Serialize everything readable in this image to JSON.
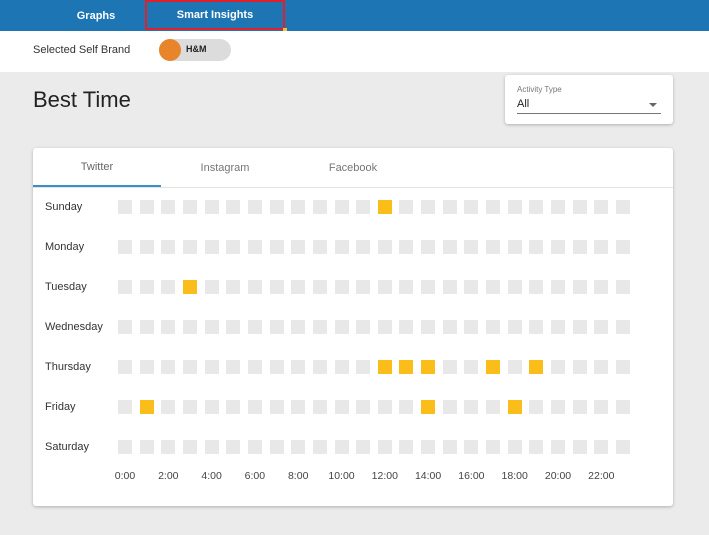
{
  "nav": {
    "tabs": [
      {
        "label": "Graphs",
        "active": false
      },
      {
        "label": "Smart Insights",
        "active": true
      }
    ]
  },
  "brand": {
    "label": "Selected Self Brand",
    "selected": "H&M",
    "knob_color": "#e8842a"
  },
  "page": {
    "title": "Best Time"
  },
  "activity": {
    "label": "Activity Type",
    "value": "All"
  },
  "social_tabs": [
    {
      "label": "Twitter",
      "active": true
    },
    {
      "label": "Instagram",
      "active": false
    },
    {
      "label": "Facebook",
      "active": false
    }
  ],
  "colors": {
    "topbar": "#1e75b3",
    "highlight": "#fbbd1a",
    "empty_cell": "#e8e8e8",
    "tab_indicator": "#3a8fc7"
  },
  "heatmap": {
    "days": [
      "Sunday",
      "Monday",
      "Tuesday",
      "Wednesday",
      "Thursday",
      "Friday",
      "Saturday"
    ],
    "hour_labels": [
      "0:00",
      "2:00",
      "4:00",
      "6:00",
      "8:00",
      "10:00",
      "12:00",
      "14:00",
      "16:00",
      "18:00",
      "20:00",
      "22:00"
    ],
    "hours_per_day": 24,
    "best_hours": {
      "Sunday": [
        12
      ],
      "Monday": [],
      "Tuesday": [
        3
      ],
      "Wednesday": [],
      "Thursday": [
        12,
        13,
        14,
        17,
        19
      ],
      "Friday": [
        1,
        14,
        18
      ],
      "Saturday": []
    }
  }
}
